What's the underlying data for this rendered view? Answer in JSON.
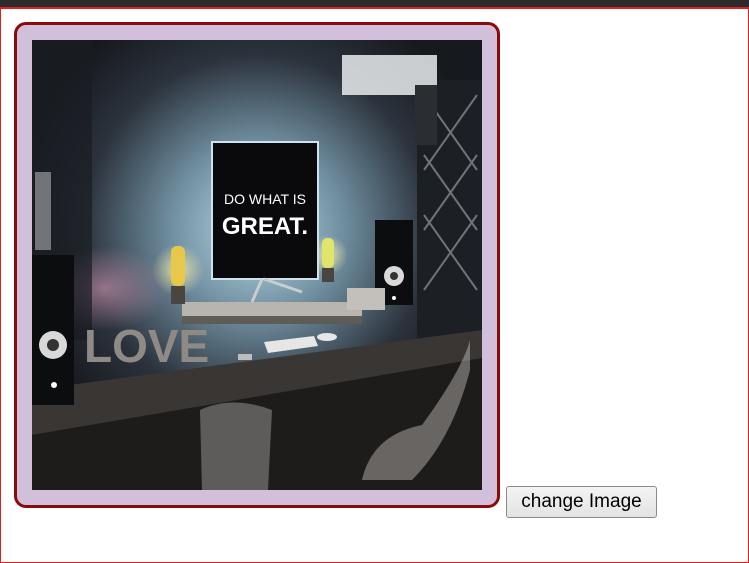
{
  "image": {
    "monitor_text_line1": "DO WHAT IS",
    "monitor_text_line2": "GREAT.",
    "decor_text": "LOVE"
  },
  "controls": {
    "change_image_label": "change Image"
  },
  "colors": {
    "frame_border": "#8b0a0a",
    "frame_fill": "#d2bfdc",
    "page_border": "#e02020"
  }
}
